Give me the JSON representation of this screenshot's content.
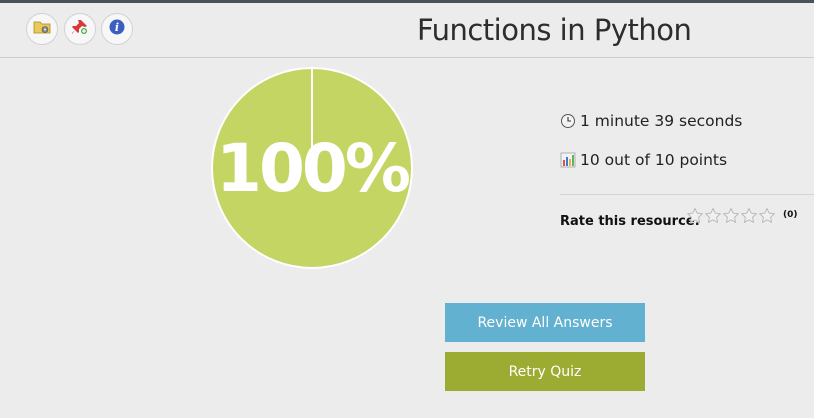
{
  "header": {
    "title": "Functions in Python",
    "tools": [
      {
        "icon": "folder-gear-icon"
      },
      {
        "icon": "pin-icon"
      },
      {
        "icon": "info-icon"
      }
    ]
  },
  "result": {
    "score_label": "100%",
    "score_fraction": 1.0,
    "chart_color": "#c5d563"
  },
  "stats": {
    "time": "1 minute 39 seconds",
    "time_icon": "clock-icon",
    "points": "10 out of 10 points",
    "points_icon": "bar-chart-icon"
  },
  "rating": {
    "label": "Rate this resource:",
    "stars_total": 5,
    "stars_filled": 0,
    "count": "(0)"
  },
  "actions": {
    "review_label": "Review All Answers",
    "retry_label": "Retry Quiz"
  },
  "colors": {
    "review_button": "#63b1d0",
    "retry_button": "#9cac32"
  }
}
